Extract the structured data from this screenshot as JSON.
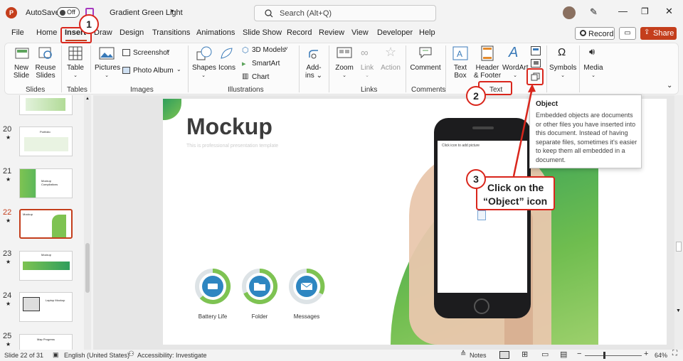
{
  "titlebar": {
    "autosave": "AutoSave",
    "toggle": "Off",
    "doc_title": "Gradient Green Light",
    "search_placeholder": "Search (Alt+Q)"
  },
  "tabs": [
    "File",
    "Home",
    "Insert",
    "Draw",
    "Design",
    "Transitions",
    "Animations",
    "Slide Show",
    "Record",
    "Review",
    "View",
    "Developer",
    "Help"
  ],
  "record_button": "Record",
  "share_button": "Share",
  "ribbon": {
    "new_slide": [
      "New",
      "Slide"
    ],
    "reuse_slides": [
      "Reuse",
      "Slides"
    ],
    "table": "Table",
    "pictures": "Pictures",
    "screenshot": "Screenshot",
    "photo_album": "Photo Album",
    "shapes": "Shapes",
    "icons": "Icons",
    "models_3d": "3D Models",
    "smartart": "SmartArt",
    "chart": "Chart",
    "addins": [
      "Add-",
      "ins"
    ],
    "zoom": "Zoom",
    "link": "Link",
    "action": "Action",
    "comment": "Comment",
    "textbox": [
      "Text",
      "Box"
    ],
    "header_footer": [
      "Header",
      "& Footer"
    ],
    "wordart": "WordArt",
    "symbols": "Symbols",
    "media": "Media"
  },
  "groups": [
    "Slides",
    "Tables",
    "Images",
    "Illustrations",
    "Links",
    "Comments",
    "Text"
  ],
  "tooltip": {
    "title": "Object",
    "body": "Embedded objects are documents or other files you have inserted into this document. Instead of having separate files, sometimes it's easier to keep them all embedded in a document."
  },
  "slides_panel": {
    "numbers": [
      "20",
      "21",
      "22",
      "23",
      "24",
      "25"
    ],
    "thumb_titles": [
      "Portfolio",
      "Mockup Compilations",
      "Mockup",
      "Mockup",
      "Laptop Mockup",
      "Map Progress"
    ]
  },
  "slide": {
    "title": "Mockup",
    "subtitle": "This is professional presentation template",
    "phone_text": "Click icon to add picture",
    "donuts": [
      "Battery Life",
      "Folder",
      "Messages"
    ]
  },
  "annotations": {
    "step1": "1",
    "step2": "2",
    "step3": "3",
    "callout_line1": "Click on the",
    "callout_line2": "“Object” icon"
  },
  "statusbar": {
    "slide_info": "Slide 22 of 31",
    "language": "English (United States)",
    "accessibility": "Accessibility: Investigate",
    "notes": "Notes",
    "zoom": "64%"
  },
  "colors": {
    "accent_red": "#d9261c",
    "share_orange": "#c43e1c",
    "green_light": "#7ec352",
    "green_dark": "#2f9e5c"
  }
}
